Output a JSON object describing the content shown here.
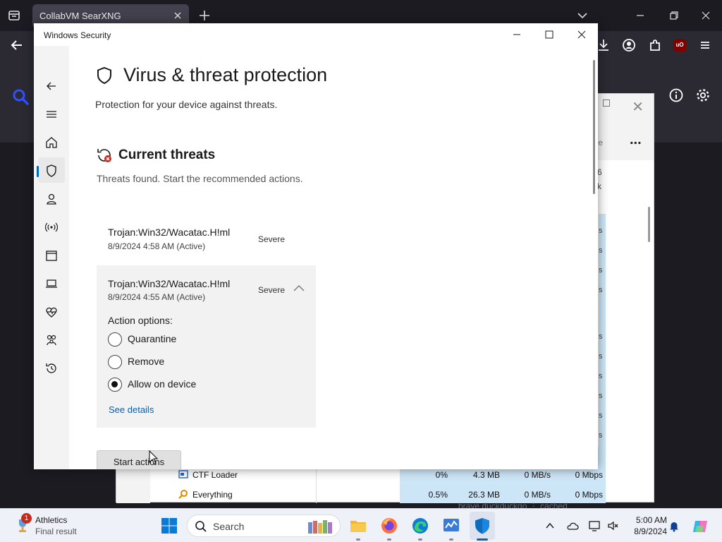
{
  "browser": {
    "tab_title": "CollabVM SearXNG"
  },
  "task_manager": {
    "cmd_text": "ode",
    "more_label": "...",
    "header_pct": "6",
    "header_sub": "k",
    "s_values": [
      "s",
      "s",
      "s",
      "s",
      "s",
      "s",
      "s",
      "s",
      "s",
      "s",
      "s"
    ],
    "rows": [
      {
        "name": "CTF Loader",
        "cpu": "0%",
        "memory": "4.3 MB",
        "disk": "0 MB/s",
        "network": "0 Mbps"
      },
      {
        "name": "Everything",
        "cpu": "0.5%",
        "memory": "26.3 MB",
        "disk": "0 MB/s",
        "network": "0 Mbps"
      }
    ]
  },
  "windows_security": {
    "title": "Windows Security",
    "page_title": "Virus & threat protection",
    "page_subtitle": "Protection for your device against threats.",
    "section_title": "Current threats",
    "section_subtitle": "Threats found. Start the recommended actions.",
    "threats": [
      {
        "name": "Trojan:Win32/Wacatac.H!ml",
        "date": "8/9/2024 4:58 AM (Active)",
        "severity": "Severe"
      },
      {
        "name": "Trojan:Win32/Wacatac.H!ml",
        "date": "8/9/2024 4:55 AM (Active)",
        "severity": "Severe"
      }
    ],
    "action_options_label": "Action options:",
    "options": [
      "Quarantine",
      "Remove",
      "Allow on device"
    ],
    "selected_option": "Allow on device",
    "see_details": "See details",
    "start_actions": "Start actions",
    "accent_color": "#0067c0"
  },
  "taskbar": {
    "weather_title": "Athletics",
    "weather_sub": "Final result",
    "weather_badge": "1",
    "search_placeholder": "Search",
    "time": "5:00 AM",
    "date": "8/9/2024",
    "faint_text": "brave  duckduckgo  ⋮  cached"
  }
}
